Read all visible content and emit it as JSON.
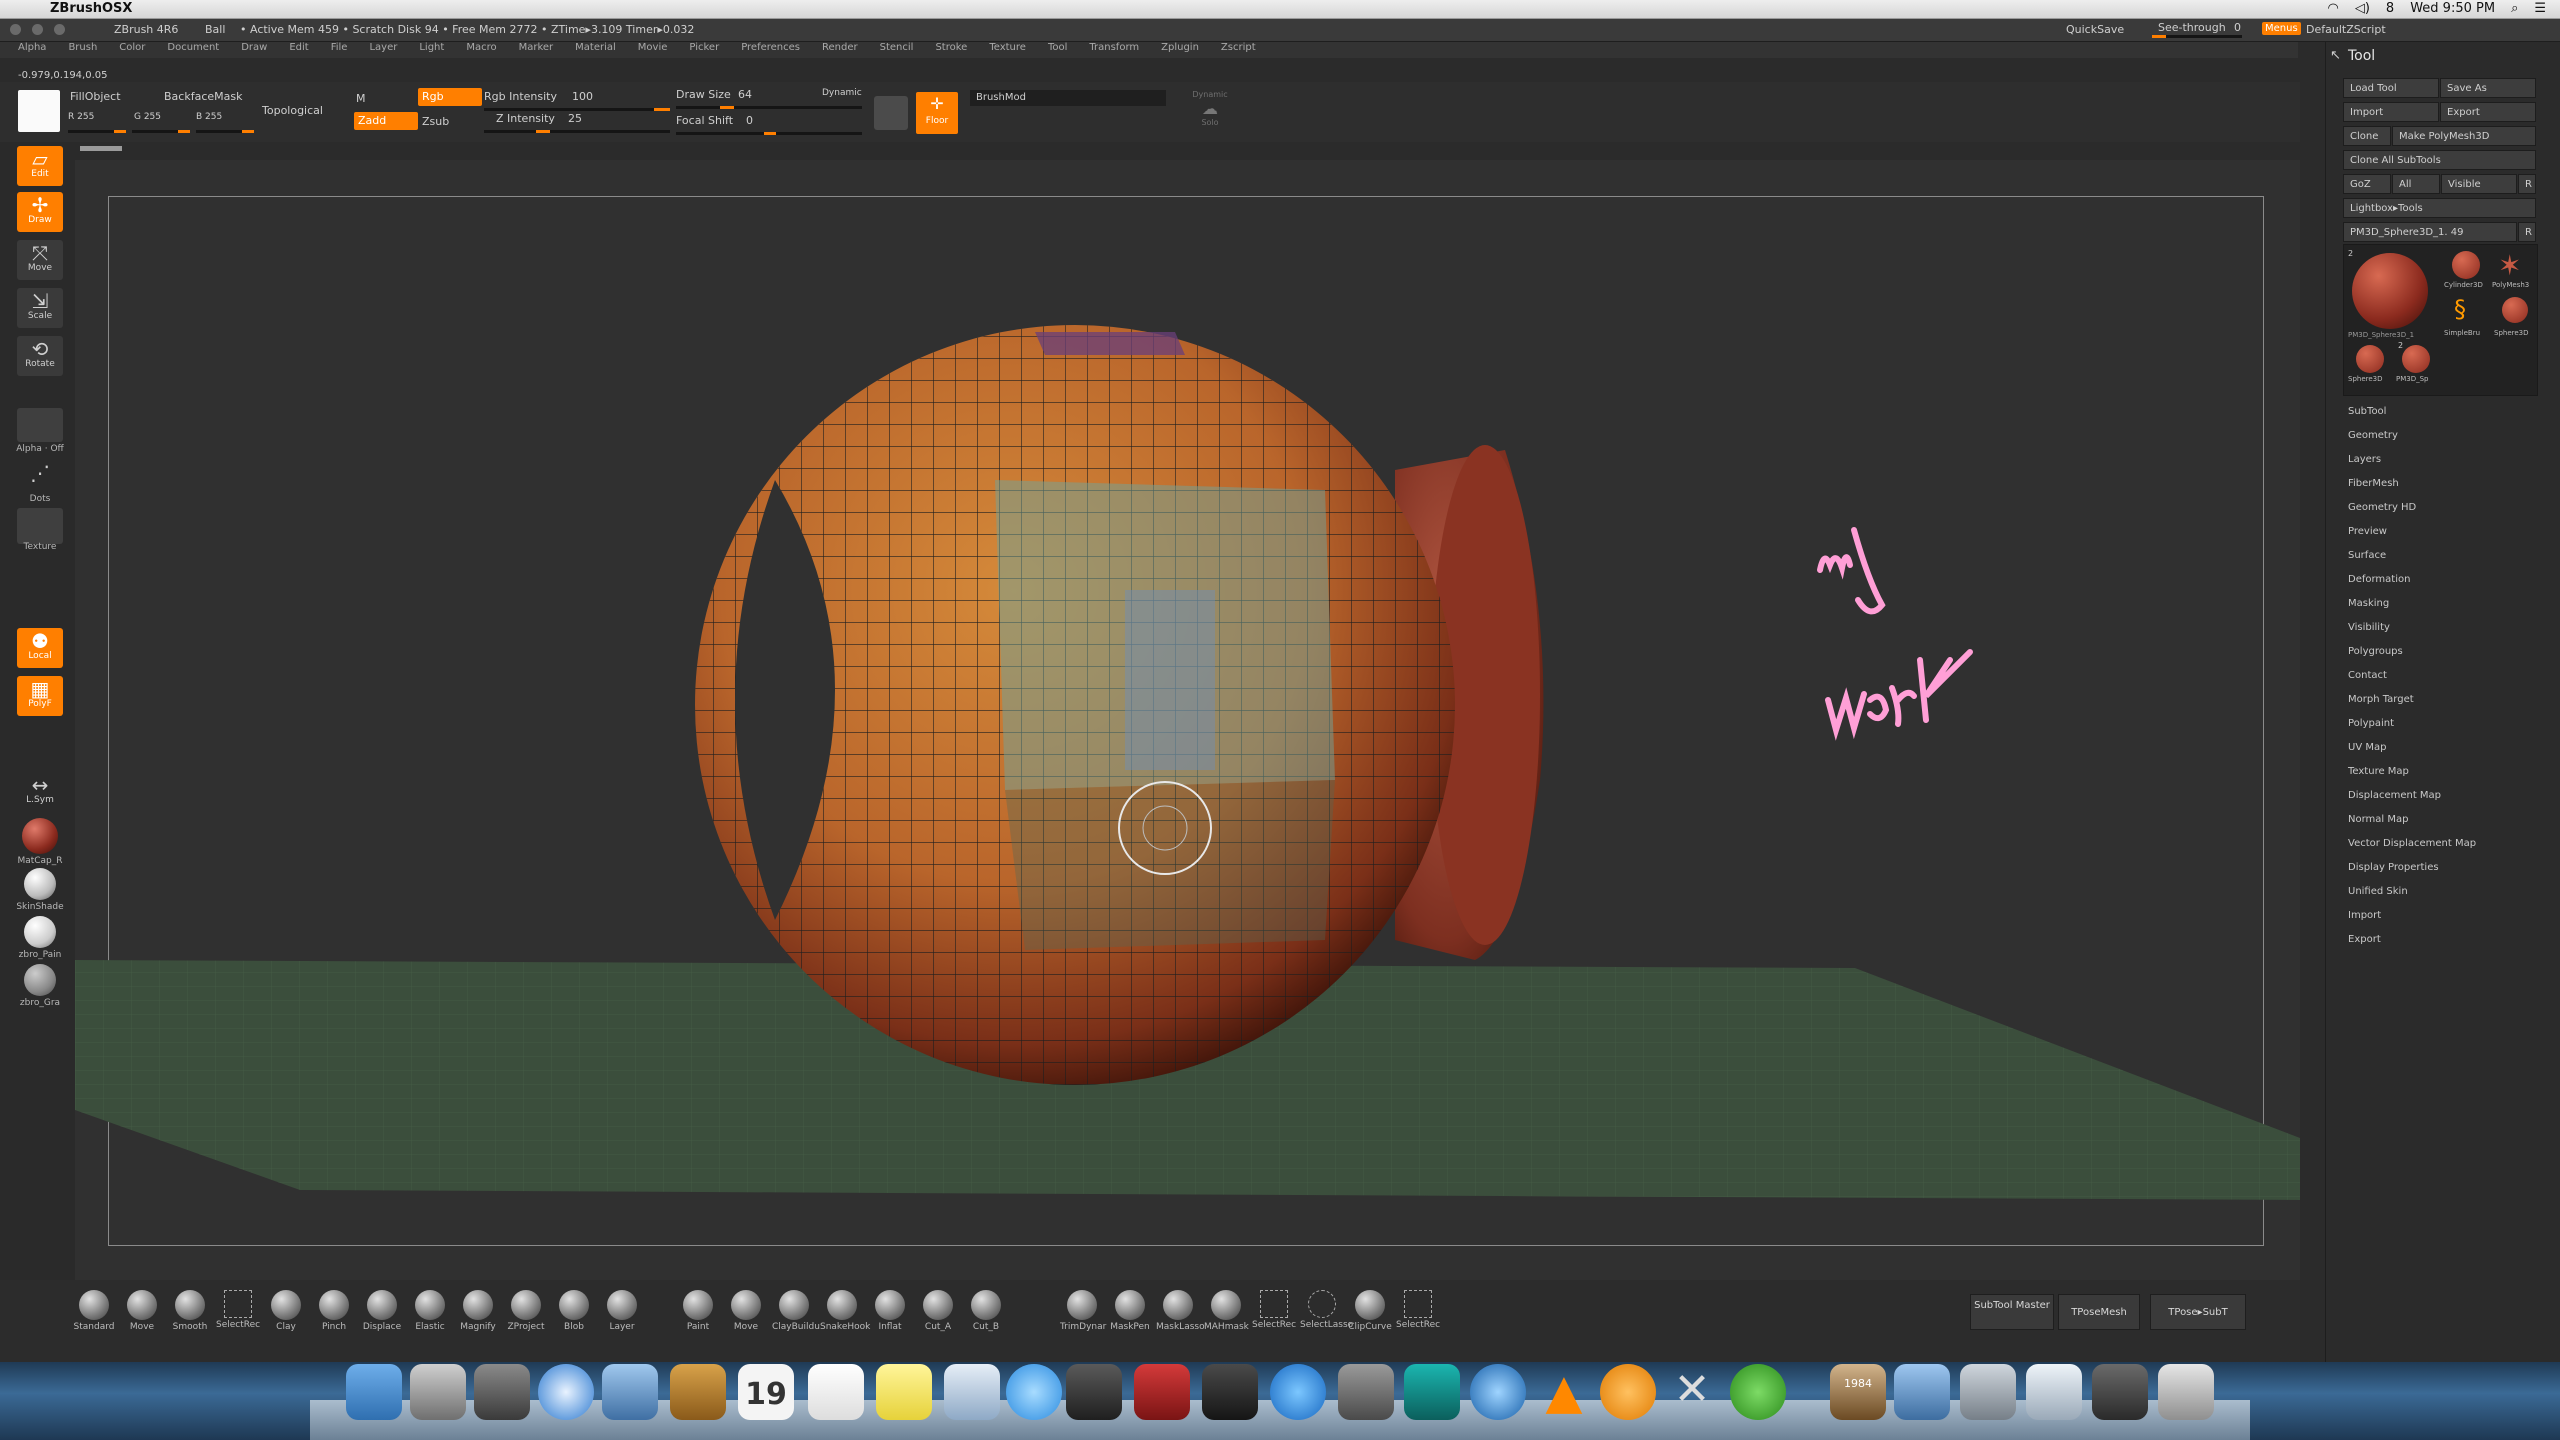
{
  "macbar": {
    "app_name": "ZBrushOSX",
    "status_items": [
      "8",
      "Wed 9:50 PM"
    ]
  },
  "titlebar": {
    "title": "ZBrush 4R6",
    "doc": "Ball",
    "stats": "• Active Mem 459 • Scratch Disk 94 • Free Mem 2772 • ZTime▸3.109 Timer▸0.032",
    "quicksave": "QuickSave",
    "seethrough": "See-through",
    "seethrough_value": "0",
    "menus_label": "Menus",
    "script": "DefaultZScript"
  },
  "menu": [
    "Alpha",
    "Brush",
    "Color",
    "Document",
    "Draw",
    "Edit",
    "File",
    "Layer",
    "Light",
    "Macro",
    "Marker",
    "Material",
    "Movie",
    "Picker",
    "Preferences",
    "Render",
    "Stencil",
    "Stroke",
    "Texture",
    "Tool",
    "Transform",
    "Zplugin",
    "Zscript"
  ],
  "coords": "-0.979,0.194,0.05",
  "shelf": {
    "fillobject": "FillObject",
    "backfacemask": "BackfaceMask",
    "topological": "Topological",
    "r": "R 255",
    "g": "G 255",
    "b": "B 255",
    "m": "M",
    "rgb": "Rgb",
    "zadd": "Zadd",
    "zsub": "Zsub",
    "rgb_intensity_label": "Rgb Intensity",
    "rgb_intensity": "100",
    "z_intensity_label": "Z Intensity",
    "z_intensity": "25",
    "draw_size_label": "Draw Size",
    "draw_size": "64",
    "dynamic": "Dynamic",
    "focal_shift_label": "Focal Shift",
    "focal_shift": "0",
    "floor": "Floor",
    "brushmod": "BrushMod",
    "solo": "Solo",
    "dynamic2": "Dynamic"
  },
  "left": {
    "tools": [
      "Edit",
      "Draw",
      "Move",
      "Scale",
      "Rotate"
    ],
    "alpha": "Alpha · Off",
    "dots": "Dots",
    "texture": "Texture",
    "local": "Local",
    "polyf": "PolyF",
    "lsym": "L.Sym",
    "materials": [
      "MatCap_R",
      "SkinShade",
      "zbro_Pain",
      "zbro_Gra"
    ]
  },
  "right": {
    "title": "Tool",
    "load_tool": "Load Tool",
    "save_as": "Save As",
    "import": "Import",
    "export": "Export",
    "clone": "Clone",
    "make_polymesh": "Make PolyMesh3D",
    "clone_all": "Clone All SubTools",
    "goz": "GoZ",
    "all": "All",
    "visible": "Visible",
    "r": "R",
    "lightbox": "Lightbox▸Tools",
    "current_tool": "PM3D_Sphere3D_1. 49",
    "thumbs": [
      "PM3D_Sphere3D_1",
      "Cylinder3D",
      "PolyMesh3",
      "SimpleBru",
      "Sphere3D",
      "Sphere3D",
      "PM3D_Sp"
    ],
    "thumb_count": "2",
    "thumb_count_b": "2",
    "sections": [
      "SubTool",
      "Geometry",
      "Layers",
      "FiberMesh",
      "Geometry HD",
      "Preview",
      "Surface",
      "Deformation",
      "Masking",
      "Visibility",
      "Polygroups",
      "Contact",
      "Morph Target",
      "Polypaint",
      "UV Map",
      "Texture Map",
      "Displacement Map",
      "Normal Map",
      "Vector Displacement Map",
      "Display Properties",
      "Unified Skin",
      "Import",
      "Export"
    ]
  },
  "bottom": {
    "brushes1": [
      "Standard",
      "Move",
      "Smooth",
      "SelectRec",
      "Clay",
      "Pinch",
      "Displace",
      "Elastic",
      "Magnify",
      "ZProject",
      "Blob",
      "Layer"
    ],
    "brushes2": [
      "Paint",
      "Move",
      "ClayBuildu",
      "SnakeHook",
      "Inflat",
      "Cut_A",
      "Cut_B"
    ],
    "brushes3": [
      "TrimDynar",
      "MaskPen",
      "MaskLasso",
      "MAHmask",
      "SelectRec",
      "SelectLasso",
      "ClipCurve",
      "SelectRec"
    ],
    "subtool_master": "SubTool Master",
    "tposemesh": "TPoseMesh",
    "tpose_subt": "TPose▸SubT"
  },
  "dock": {
    "calendar_day": "19",
    "book_label": "1984"
  },
  "scribble_text": "my work",
  "colors": {
    "accent": "#ff7f00",
    "sphere": "#c8762f",
    "handwriting": "#ff9fd6"
  }
}
